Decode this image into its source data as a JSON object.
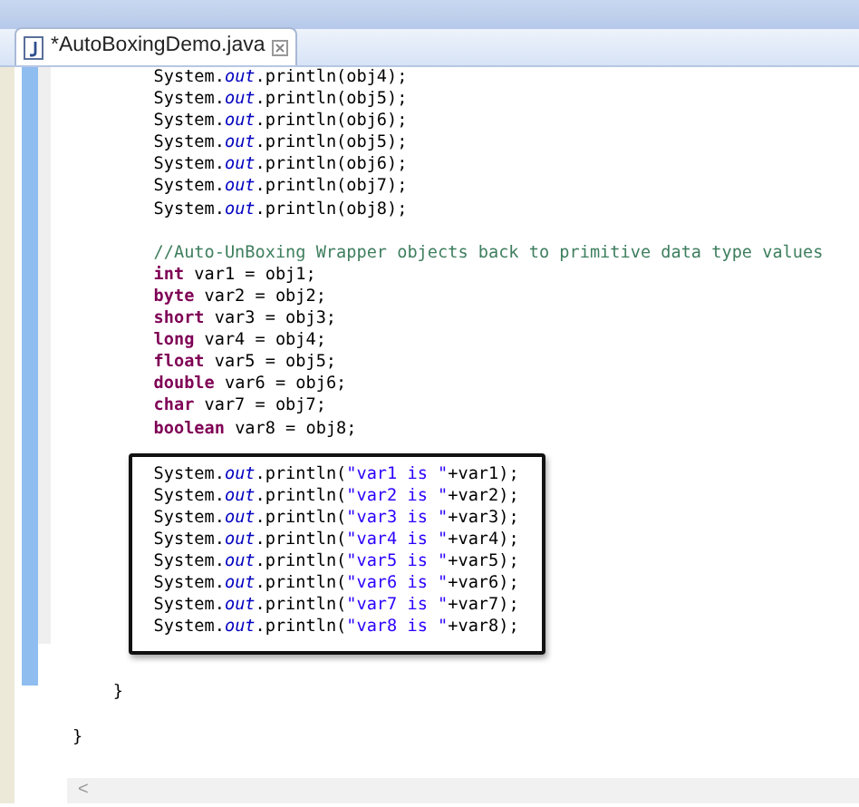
{
  "editor_tab": {
    "title": "*AutoBoxingDemo.java",
    "selected": true
  },
  "sections": [
    {
      "kind": "plain",
      "lines": [
        {
          "kind": "code",
          "segments": [
            {
              "kind": "plain",
              "text": "        System."
            },
            {
              "kind": "field",
              "text": "out"
            },
            {
              "kind": "plain",
              "text": ".println(obj4);"
            }
          ]
        },
        {
          "kind": "code",
          "segments": [
            {
              "kind": "plain",
              "text": "        System."
            },
            {
              "kind": "field",
              "text": "out"
            },
            {
              "kind": "plain",
              "text": ".println(obj5);"
            }
          ]
        },
        {
          "kind": "code",
          "segments": [
            {
              "kind": "plain",
              "text": "        System."
            },
            {
              "kind": "field",
              "text": "out"
            },
            {
              "kind": "plain",
              "text": ".println(obj6);"
            }
          ]
        },
        {
          "kind": "code",
          "segments": [
            {
              "kind": "plain",
              "text": "        System."
            },
            {
              "kind": "field",
              "text": "out"
            },
            {
              "kind": "plain",
              "text": ".println(obj5);"
            }
          ]
        },
        {
          "kind": "code",
          "segments": [
            {
              "kind": "plain",
              "text": "        System."
            },
            {
              "kind": "field",
              "text": "out"
            },
            {
              "kind": "plain",
              "text": ".println(obj6);"
            }
          ]
        },
        {
          "kind": "code",
          "segments": [
            {
              "kind": "plain",
              "text": "        System."
            },
            {
              "kind": "field",
              "text": "out"
            },
            {
              "kind": "plain",
              "text": ".println(obj7);"
            }
          ]
        },
        {
          "kind": "code",
          "segments": [
            {
              "kind": "plain",
              "text": "        System."
            },
            {
              "kind": "field",
              "text": "out"
            },
            {
              "kind": "plain",
              "text": ".println(obj8);"
            }
          ]
        },
        {
          "kind": "blank"
        },
        {
          "kind": "code",
          "segments": [
            {
              "kind": "comment",
              "text": "        //Auto-UnBoxing Wrapper objects back to primitive data type values"
            }
          ]
        },
        {
          "kind": "code",
          "segments": [
            {
              "kind": "keyword",
              "text": "        int"
            },
            {
              "kind": "plain",
              "text": " var1 = obj1;"
            }
          ]
        },
        {
          "kind": "code",
          "segments": [
            {
              "kind": "keyword",
              "text": "        byte"
            },
            {
              "kind": "plain",
              "text": " var2 = obj2;"
            }
          ]
        },
        {
          "kind": "code",
          "segments": [
            {
              "kind": "keyword",
              "text": "        short"
            },
            {
              "kind": "plain",
              "text": " var3 = obj3;"
            }
          ]
        },
        {
          "kind": "code",
          "segments": [
            {
              "kind": "keyword",
              "text": "        long"
            },
            {
              "kind": "plain",
              "text": " var4 = obj4;"
            }
          ]
        },
        {
          "kind": "code",
          "segments": [
            {
              "kind": "keyword",
              "text": "        float"
            },
            {
              "kind": "plain",
              "text": " var5 = obj5;"
            }
          ]
        },
        {
          "kind": "code",
          "segments": [
            {
              "kind": "keyword",
              "text": "        double"
            },
            {
              "kind": "plain",
              "text": " var6 = obj6;"
            }
          ]
        },
        {
          "kind": "code",
          "segments": [
            {
              "kind": "keyword",
              "text": "        char"
            },
            {
              "kind": "plain",
              "text": " var7 = obj7;"
            }
          ]
        },
        {
          "kind": "code",
          "segments": [
            {
              "kind": "keyword",
              "text": "        boolean"
            },
            {
              "kind": "plain",
              "text": " var8 = obj8;"
            }
          ]
        }
      ]
    },
    {
      "kind": "boxed",
      "lines": [
        {
          "kind": "code",
          "segments": [
            {
              "kind": "plain",
              "text": "        System."
            },
            {
              "kind": "field",
              "text": "out"
            },
            {
              "kind": "plain",
              "text": ".println("
            },
            {
              "kind": "string",
              "text": "\"var1 is \""
            },
            {
              "kind": "plain",
              "text": "+var1);"
            }
          ]
        },
        {
          "kind": "code",
          "segments": [
            {
              "kind": "plain",
              "text": "        System."
            },
            {
              "kind": "field",
              "text": "out"
            },
            {
              "kind": "plain",
              "text": ".println("
            },
            {
              "kind": "string",
              "text": "\"var2 is \""
            },
            {
              "kind": "plain",
              "text": "+var2);"
            }
          ]
        },
        {
          "kind": "code",
          "segments": [
            {
              "kind": "plain",
              "text": "        System."
            },
            {
              "kind": "field",
              "text": "out"
            },
            {
              "kind": "plain",
              "text": ".println("
            },
            {
              "kind": "string",
              "text": "\"var3 is \""
            },
            {
              "kind": "plain",
              "text": "+var3);"
            }
          ]
        },
        {
          "kind": "code",
          "segments": [
            {
              "kind": "plain",
              "text": "        System."
            },
            {
              "kind": "field",
              "text": "out"
            },
            {
              "kind": "plain",
              "text": ".println("
            },
            {
              "kind": "string",
              "text": "\"var4 is \""
            },
            {
              "kind": "plain",
              "text": "+var4);"
            }
          ]
        },
        {
          "kind": "code",
          "segments": [
            {
              "kind": "plain",
              "text": "        System."
            },
            {
              "kind": "field",
              "text": "out"
            },
            {
              "kind": "plain",
              "text": ".println("
            },
            {
              "kind": "string",
              "text": "\"var5 is \""
            },
            {
              "kind": "plain",
              "text": "+var5);"
            }
          ]
        },
        {
          "kind": "code",
          "segments": [
            {
              "kind": "plain",
              "text": "        System."
            },
            {
              "kind": "field",
              "text": "out"
            },
            {
              "kind": "plain",
              "text": ".println("
            },
            {
              "kind": "string",
              "text": "\"var6 is \""
            },
            {
              "kind": "plain",
              "text": "+var6);"
            }
          ]
        },
        {
          "kind": "code",
          "segments": [
            {
              "kind": "plain",
              "text": "        System."
            },
            {
              "kind": "field",
              "text": "out"
            },
            {
              "kind": "plain",
              "text": ".println("
            },
            {
              "kind": "string",
              "text": "\"var7 is \""
            },
            {
              "kind": "plain",
              "text": "+var7);"
            }
          ]
        },
        {
          "kind": "code",
          "segments": [
            {
              "kind": "plain",
              "text": "        System."
            },
            {
              "kind": "field",
              "text": "out"
            },
            {
              "kind": "plain",
              "text": ".println("
            },
            {
              "kind": "string",
              "text": "\"var8 is \""
            },
            {
              "kind": "plain",
              "text": "+var8);"
            }
          ]
        }
      ]
    },
    {
      "kind": "plain",
      "lines": [
        {
          "kind": "blank"
        },
        {
          "kind": "code",
          "segments": [
            {
              "kind": "plain",
              "text": "    }"
            }
          ]
        },
        {
          "kind": "blank"
        },
        {
          "kind": "code",
          "segments": [
            {
              "kind": "plain",
              "text": "}"
            }
          ]
        }
      ]
    }
  ],
  "scrollbar": {
    "arrow": "<"
  }
}
